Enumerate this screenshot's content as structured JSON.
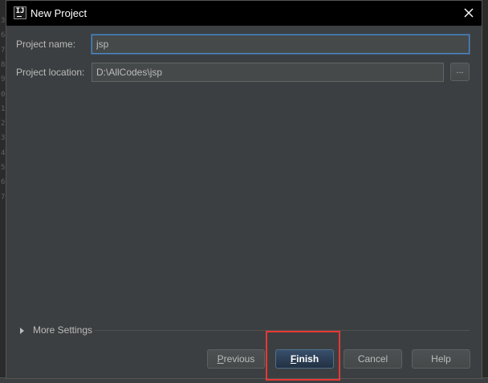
{
  "window": {
    "title": "New Project",
    "logo_text": "IJ"
  },
  "background_gutter": [
    "3",
    "6",
    "7",
    "8",
    "9",
    "0",
    "1",
    "2",
    "3",
    "4",
    "5",
    "6",
    "7"
  ],
  "form": {
    "project_name_label": "Project name:",
    "project_name_value": "jsp",
    "project_location_label": "Project location:",
    "project_location_value": "D:\\AllCodes\\jsp",
    "browse_label": "..."
  },
  "more_settings": {
    "label": "More Settings",
    "expanded": false
  },
  "buttons": {
    "previous": {
      "mnemonic": "P",
      "rest": "revious"
    },
    "finish": {
      "mnemonic": "F",
      "rest": "inish"
    },
    "cancel": "Cancel",
    "help": "Help"
  },
  "colors": {
    "dialog_bg": "#3c3f41",
    "titlebar_bg": "#000000",
    "focus_border": "#4a88c7",
    "primary_button": "#2f4a66",
    "highlight": "#e53935"
  },
  "icons": {
    "close": "close-icon",
    "expand": "triangle-right-icon",
    "logo": "intellij-logo-icon"
  }
}
